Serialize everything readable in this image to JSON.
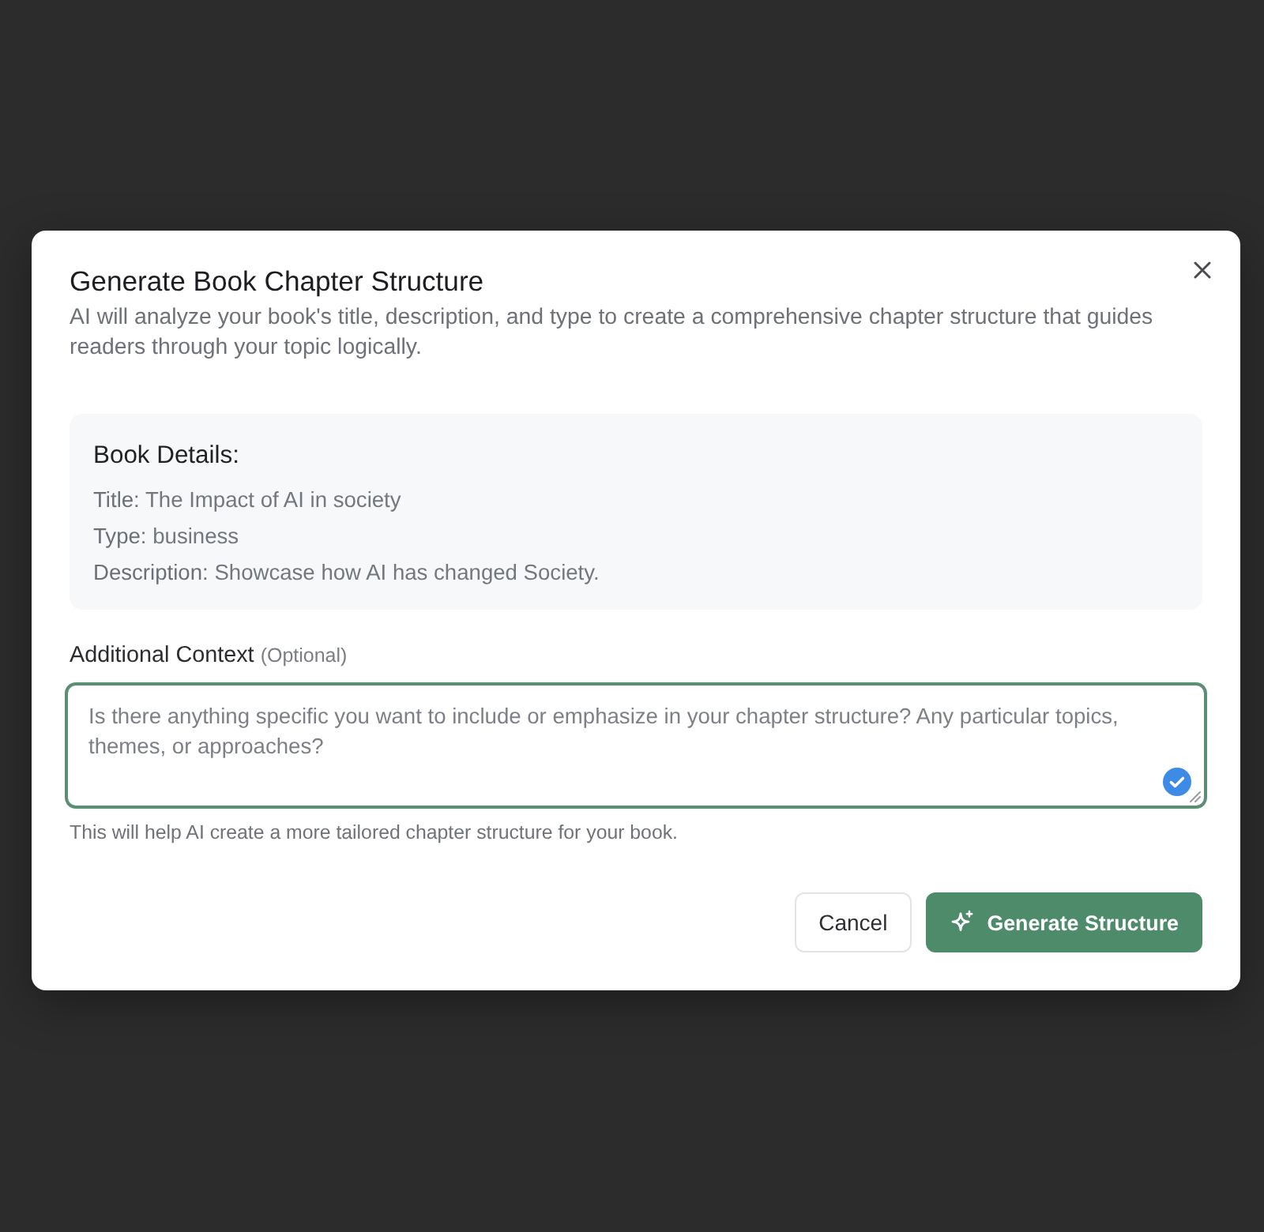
{
  "dialog": {
    "title": "Generate Book Chapter Structure",
    "description": "AI will analyze your book's title, description, and type to create a comprehensive chapter structure that guides readers through your topic logically."
  },
  "book_details": {
    "heading": "Book Details:",
    "rows": [
      {
        "label": "Title:",
        "value": "The Impact of AI in society"
      },
      {
        "label": "Type:",
        "value": "business"
      },
      {
        "label": "Description:",
        "value": "Showcase how AI has changed Society."
      }
    ]
  },
  "context": {
    "label": "Additional Context",
    "optional": "(Optional)",
    "placeholder": "Is there anything specific you want to include or emphasize in your chapter structure? Any particular topics, themes, or approaches?",
    "hint": "This will help AI create a more tailored chapter structure for your book."
  },
  "buttons": [
    {
      "label": "Cancel",
      "kind": "secondary"
    },
    {
      "label": "Generate Structure",
      "kind": "primary"
    }
  ]
}
